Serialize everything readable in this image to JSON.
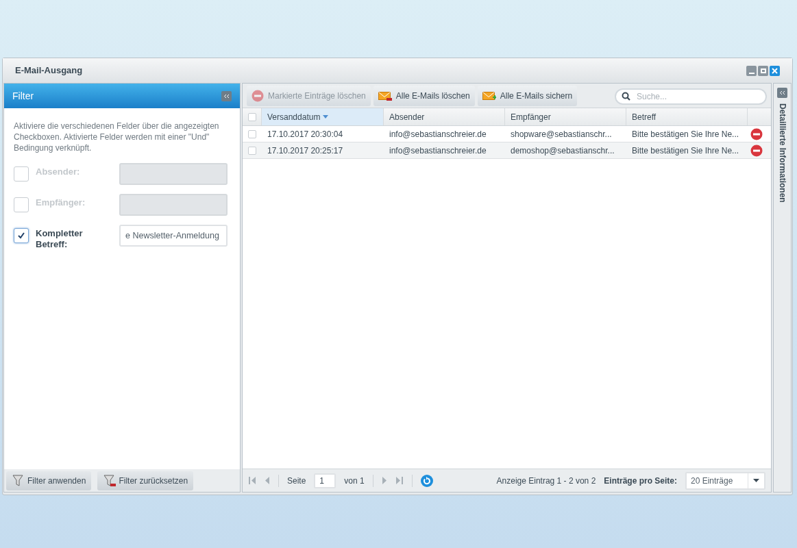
{
  "window": {
    "title": "E-Mail-Ausgang"
  },
  "filter": {
    "title": "Filter",
    "description": "Aktiviere die verschiedenen Felder über die angezeigten Checkboxen. Aktivierte Felder werden mit einer \"Und\" Bedingung verknüpft.",
    "fields": [
      {
        "label": "Absender:",
        "checked": false
      },
      {
        "label": "Empfänger:",
        "checked": false
      },
      {
        "label": "Kompletter Betreff:",
        "checked": true,
        "value": "e Newsletter-Anmeldung"
      }
    ],
    "buttons": [
      {
        "label": "Filter anwenden",
        "kind": "apply"
      },
      {
        "label": "Filter zurücksetzen",
        "kind": "reset"
      }
    ]
  },
  "toolbar": {
    "buttons": [
      {
        "label": "Markierte Einträge löschen",
        "kind": "delete",
        "disabled": true
      },
      {
        "label": "Alle E-Mails löschen",
        "kind": "mail-delete",
        "disabled": false
      },
      {
        "label": "Alle E-Mails sichern",
        "kind": "mail-save",
        "disabled": false
      }
    ],
    "search": {
      "placeholder": "Suche..."
    }
  },
  "table": {
    "all_checked": false,
    "columns": [
      {
        "label": "Versanddatum",
        "sorted": true
      },
      {
        "label": "Absender",
        "sorted": false
      },
      {
        "label": "Empfänger",
        "sorted": false
      },
      {
        "label": "Betreff",
        "sorted": false
      }
    ],
    "rows": [
      {
        "checked": false,
        "cells": [
          "17.10.2017 20:30:04",
          "info@sebastianschreier.de",
          "shopware@sebastianschr...",
          "Bitte bestätigen Sie Ihre Ne..."
        ]
      },
      {
        "checked": false,
        "cells": [
          "17.10.2017 20:25:17",
          "info@sebastianschreier.de",
          "demoshop@sebastianschr...",
          "Bitte bestätigen Sie Ihre Ne..."
        ]
      }
    ]
  },
  "pager": {
    "page_label": "Seite",
    "page": "1",
    "of": "von 1",
    "info": "Anzeige Eintrag 1 - 2 von 2",
    "per_page_label": "Einträge pro Seite:",
    "per_page": "20 Einträge"
  },
  "side_panel": {
    "title": "Detaillierte Informationen"
  }
}
